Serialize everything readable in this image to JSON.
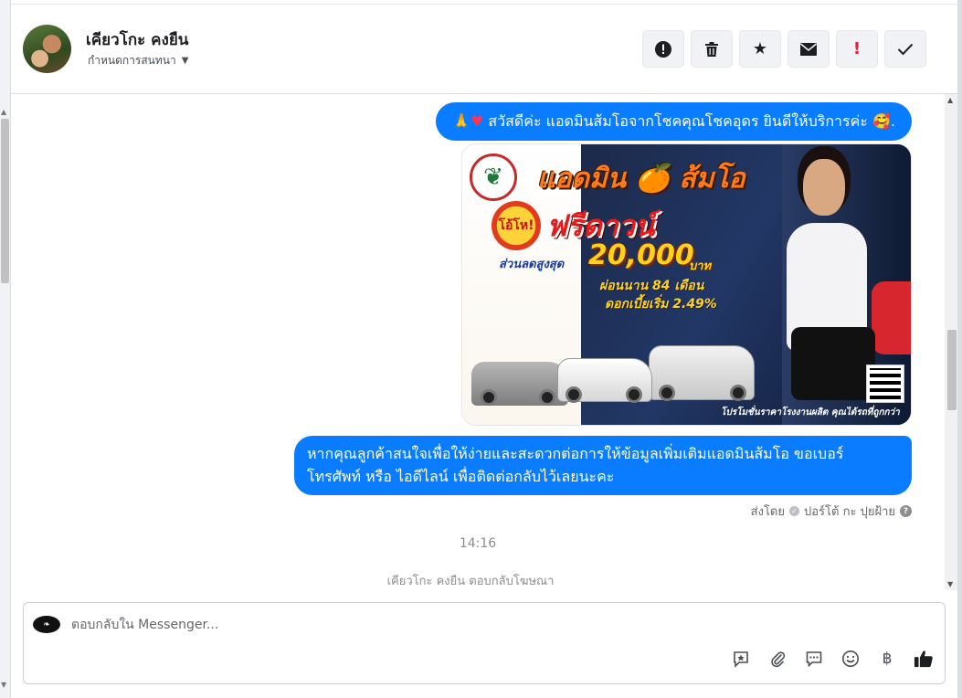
{
  "header": {
    "contact_name": "เคียวโกะ คงยืน",
    "assign_label": "กำหนดการสนทนา",
    "toolbar": {
      "spam_icon": "alert-circle-icon",
      "delete_icon": "trash-icon",
      "star_icon": "star-icon",
      "mail_icon": "envelope-icon",
      "follow_up_label": "!",
      "done_icon": "checkmark-icon"
    }
  },
  "conversation": {
    "greeting": {
      "prefix": "🙏",
      "heart": "♥",
      "text": " สวัสดีค่ะ แอดมินส้มโอจากโชคคุณโชคอุดร ยินดีให้บริการค่ะ ",
      "suffix": "🥰."
    },
    "ad": {
      "headline": "แอดมิน 🍊 ส้มโอ",
      "burst": "โอ้โห!",
      "freedown": "ฟรีดาวน์",
      "discount_label": "ส่วนลดสูงสุด",
      "amount": "20,000",
      "currency": "บาท",
      "installment": "ผ่อนนาน 84 เดือน",
      "interest": "ดอกเบี้ยเริ่ม 2.49%",
      "footer": "โปรโมชั่นราคาโรงงานผลิต คุณได้รถที่ถูกกว่า"
    },
    "followup": "หากคุณลูกค้าสนใจเพื่อให้ง่ายและสะดวกต่อการให้ข้อมูลเพิ่มเติมแอดมินส้มโอ ขอเบอร์โทรศัพท์ หรือ ไอดีไลน์ เพื่อติดต่อกลับไว้เลยนะคะ",
    "sent_by_label": "ส่งโดย",
    "sent_by_name": "ปอร์โต้ กะ ปุยฝ้าย",
    "timestamp": "14:16",
    "event": "เคียวโกะ คงยืน ตอบกลับโฆษณา"
  },
  "composer": {
    "placeholder": "ตอบกลับใน Messenger...",
    "tools": [
      "saved-reply-icon",
      "attachment-icon",
      "comment-icon",
      "emoji-icon",
      "baht-icon",
      "like-icon"
    ],
    "baht_symbol": "฿"
  },
  "colors": {
    "bubble": "#0a7cff",
    "accent_red": "#e41e3f"
  }
}
